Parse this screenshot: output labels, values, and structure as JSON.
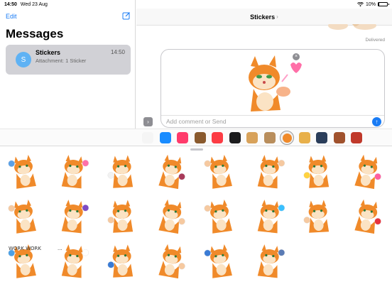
{
  "status_bar": {
    "time": "14:50",
    "date": "Wed 23 Aug",
    "wifi_icon": "wifi-icon",
    "battery_text": "10%",
    "battery_level": 0.1
  },
  "sidebar": {
    "edit_label": "Edit",
    "compose_icon": "compose-icon",
    "title": "Messages",
    "conversations": [
      {
        "avatar_letter": "S",
        "name": "Stickers",
        "time": "14:50",
        "preview": "Attachment: 1 Sticker",
        "selected": true
      }
    ]
  },
  "conversation": {
    "title": "Stickers",
    "title_chevron": "›",
    "delivered_label": "Delivered",
    "compose": {
      "placeholder": "Add comment or Send",
      "attached_sticker": "lynx-blowing-kiss-sticker",
      "remove_icon": "×",
      "send_icon": "↑"
    },
    "expand_icon": "›"
  },
  "app_strip": {
    "apps": [
      {
        "name": "photos-app",
        "color": "#f5f5f5"
      },
      {
        "name": "app-store-app",
        "color": "#1a8cff"
      },
      {
        "name": "search-images-app",
        "color": "#ff3b6b"
      },
      {
        "name": "memoji-app",
        "color": "#8a5a2e"
      },
      {
        "name": "music-app",
        "color": "#fc3c44"
      },
      {
        "name": "digital-touch-app",
        "color": "#1c1c1e"
      },
      {
        "name": "sticker-pack-dog",
        "color": "#d8a25a"
      },
      {
        "name": "sticker-pack-pug",
        "color": "#b98e5c"
      },
      {
        "name": "sticker-pack-lynx",
        "color": "#f08a2a",
        "selected": true
      },
      {
        "name": "sticker-pack-lion",
        "color": "#e8b04a"
      },
      {
        "name": "sticker-pack-suit",
        "color": "#2b3e5a"
      },
      {
        "name": "sticker-pack-man",
        "color": "#a0522d"
      },
      {
        "name": "sticker-pack-chef",
        "color": "#c0392b"
      }
    ]
  },
  "sticker_drawer": {
    "grabber": "drawer-grabber",
    "stickers": [
      {
        "name": "lynx-crying-sticker",
        "accent": "#5aa0e6"
      },
      {
        "name": "lynx-heart-sticker",
        "accent": "#ff6fa8"
      },
      {
        "name": "lynx-grumpy-sticker",
        "accent": "#f2f2f2"
      },
      {
        "name": "lynx-angry-sticker",
        "accent": "#a83a5a"
      },
      {
        "name": "lynx-thumbs-up-sticker",
        "accent": "#f6c9a0"
      },
      {
        "name": "lynx-lounging-sticker",
        "accent": "#f6c9a0"
      },
      {
        "name": "lynx-shocked-sticker",
        "accent": "#ffd23f"
      },
      {
        "name": "lynx-hearts-sticker",
        "accent": "#ff5fa0"
      },
      {
        "name": "lynx-facepalm-sticker",
        "accent": "#f6c9a0"
      },
      {
        "name": "lynx-dancing-sticker",
        "accent": "#7e4bc4"
      },
      {
        "name": "lynx-shy-sticker",
        "accent": "#f6c9a0"
      },
      {
        "name": "lynx-hissing-sticker",
        "accent": "#f6c9a0"
      },
      {
        "name": "lynx-waving-sticker",
        "accent": "#f6c9a0"
      },
      {
        "name": "lynx-tearful-sticker",
        "accent": "#3ac0ff"
      },
      {
        "name": "lynx-smirk-sticker",
        "accent": "#f6c9a0"
      },
      {
        "name": "lynx-rose-sticker",
        "accent": "#e8323c"
      },
      {
        "name": "lynx-work-sticker",
        "accent": "#4aa0e6",
        "caption": "WORK  WORK"
      },
      {
        "name": "lynx-thinking-sticker",
        "accent": "#ffffff",
        "caption": "..."
      },
      {
        "name": "lynx-frustrated-sticker",
        "accent": "#3a7bd5"
      },
      {
        "name": "lynx-arms-crossed-sticker",
        "accent": "#f6c9a0"
      },
      {
        "name": "lynx-crying-hands-sticker",
        "accent": "#3a7bd5"
      },
      {
        "name": "lynx-hug-sticker",
        "accent": "#5a7bb5"
      }
    ]
  },
  "colors": {
    "accent": "#1a7cf5",
    "lynx_orange": "#f08a2a",
    "lynx_light": "#fbe3c4",
    "selected_row": "#d1d1d6"
  }
}
